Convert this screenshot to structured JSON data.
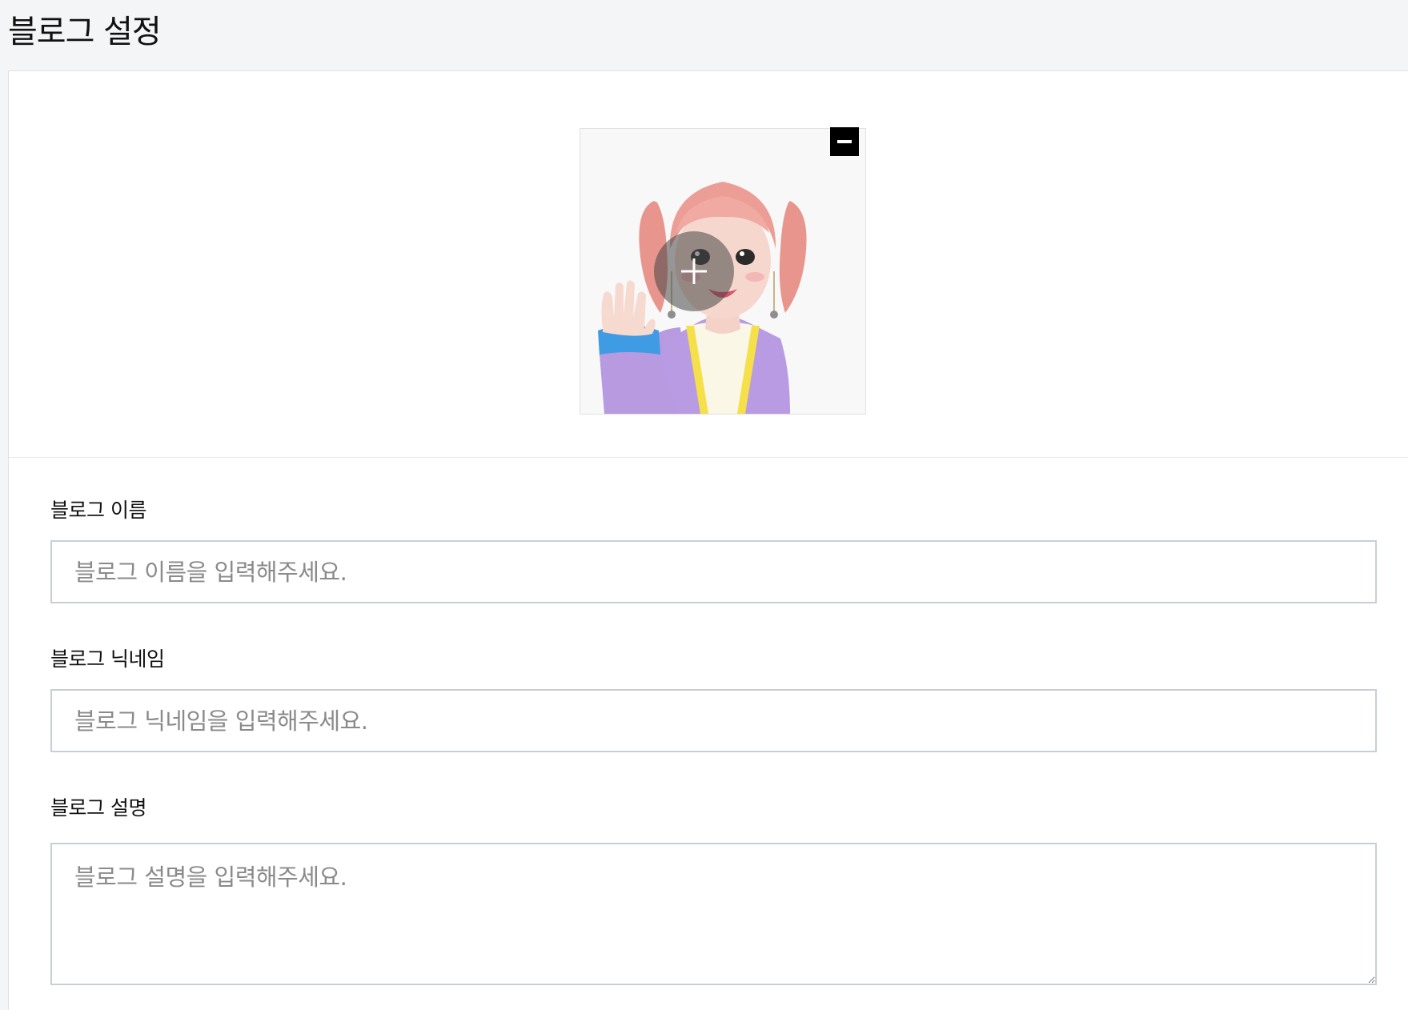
{
  "page": {
    "title": "블로그 설정"
  },
  "profile_image": {
    "remove_icon": "minus-icon",
    "upload_icon": "plus-icon",
    "image_description_icon": "avatar-image"
  },
  "fields": {
    "name": {
      "label": "블로그 이름",
      "placeholder": "블로그 이름을 입력해주세요.",
      "value": ""
    },
    "nickname": {
      "label": "블로그 닉네임",
      "placeholder": "블로그 닉네임을 입력해주세요.",
      "value": ""
    },
    "description": {
      "label": "블로그 설명",
      "placeholder": "블로그 설명을 입력해주세요.",
      "value": ""
    }
  },
  "colors": {
    "page_background": "#f4f5f7",
    "panel_background": "#ffffff",
    "input_border": "#c9ced6",
    "placeholder_text": "#8a8a8a",
    "remove_button": "#000000"
  }
}
